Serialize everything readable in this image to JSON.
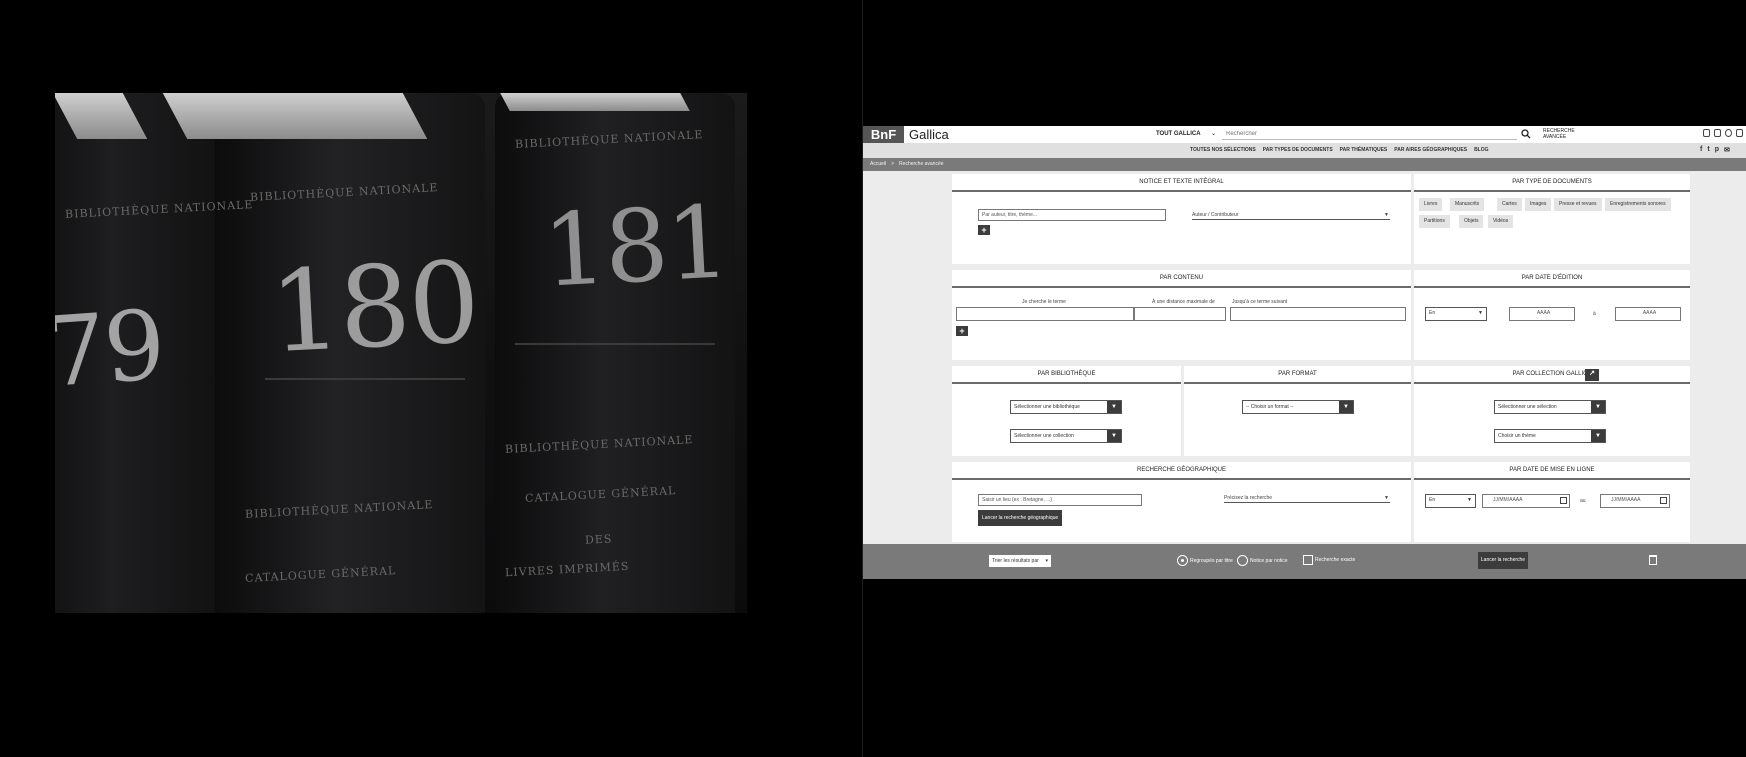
{
  "hero": {
    "volumes": [
      "79",
      "180",
      "181"
    ],
    "spine_text": [
      "BIBLIOTHÈQUE NATIONALE",
      "CATALOGUE GÉNÉRAL",
      "DES",
      "LIVRES IMPRIMÉS"
    ]
  },
  "header": {
    "logo_bnf": "BnF",
    "logo_gallica": "Gallica",
    "scope_label": "TOUT GALLICA",
    "search_placeholder": "Rechercher",
    "advanced_link": "RECHERCHE AVANCÉE"
  },
  "nav": {
    "items": [
      "TOUTES NOS SÉLECTIONS",
      "PAR TYPES DE DOCUMENTS",
      "PAR THÉMATIQUES",
      "PAR AIRES GÉOGRAPHIQUES",
      "BLOG"
    ]
  },
  "breadcrumb": {
    "home": "Accueil",
    "separator": ">",
    "current": "Recherche avancée"
  },
  "notice_panel": {
    "title": "NOTICE ET TEXTE INTÉGRAL",
    "input_placeholder": "Par auteur, titre, thème...",
    "select_value": "Auteur / Contributeur"
  },
  "type_panel": {
    "title": "PAR TYPE DE DOCUMENTS",
    "chips": [
      "Livres",
      "Manuscrits",
      "Cartes",
      "Images",
      "Presse et revues",
      "Enregistrements sonores",
      "Partitions",
      "Objets",
      "Vidéos"
    ]
  },
  "content_panel": {
    "title": "PAR CONTENU",
    "labels": [
      "Je cherche le terme",
      "À une distance maximale de",
      "Jusqu'à ce terme suivant"
    ]
  },
  "edition_panel": {
    "title": "PAR DATE D'ÉDITION",
    "select_value": "En",
    "from_placeholder": "AAAA",
    "to_label": "à",
    "to_placeholder": "AAAA"
  },
  "library_panel": {
    "title": "PAR BIBLIOTHÈQUE",
    "select_library": "Sélectionner une bibliothèque",
    "select_collection": "Sélectionner une collection"
  },
  "format_panel": {
    "title": "PAR FORMAT",
    "select_value": "-- Choisir un format --"
  },
  "collections_panel": {
    "title": "PAR COLLECTION GALLICA",
    "select_selection": "Sélectionner une sélection",
    "select_all": "Choisir un thème"
  },
  "geo_panel": {
    "title": "RECHERCHE GÉOGRAPHIQUE",
    "input_placeholder": "Saisir un lieu (ex : Bretagne, ...)",
    "select_value": "Précisez la recherche",
    "button": "Lancer la recherche géographique"
  },
  "online_panel": {
    "title": "PAR DATE DE MISE EN LIGNE",
    "select_value": "En",
    "from_placeholder": "JJ/MM/AAAA",
    "to_label": "au",
    "to_placeholder": "JJ/MM/AAAA"
  },
  "footer": {
    "save_select": "Trier les résultats par",
    "radio1": "Regroupés par titre",
    "radio2": "Notice par notice",
    "checkbox": "Recherche exacte",
    "launch": "Lancer la recherche"
  }
}
